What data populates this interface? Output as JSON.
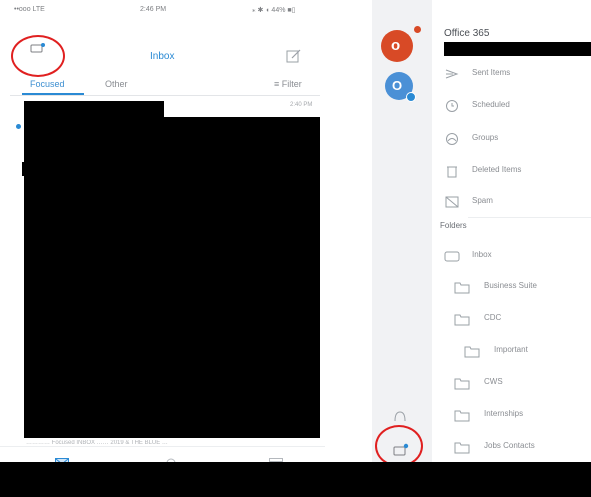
{
  "inbox": {
    "status_carrier": "••ooo LTE",
    "status_time": "2:46 PM",
    "status_battery": "⁎ ✱ ◖ 44% ■▯",
    "title": "Inbox",
    "tab_focused": "Focused",
    "tab_other": "Other",
    "filter_label": "≡ Filter",
    "message_time": "2:40 PM",
    "preview_text": "………… Focused INBOX …… 2019 & THE BLUE …"
  },
  "drawer": {
    "account_name": "Office 365",
    "accounts": [
      {
        "icon": "office-logo-icon",
        "letter": "o",
        "color": "#d84a26"
      },
      {
        "icon": "outlook-logo-icon",
        "letter": "O",
        "color": "#4a90d6"
      }
    ],
    "smart_items": [
      {
        "label": "Sent Items",
        "icon": "send-icon"
      },
      {
        "label": "Scheduled",
        "icon": "clock-icon"
      },
      {
        "label": "Groups",
        "icon": "groups-icon"
      },
      {
        "label": "Deleted Items",
        "icon": "trash-icon"
      },
      {
        "label": "Spam",
        "icon": "spam-icon"
      }
    ],
    "folders_header": "Folders",
    "folders": [
      {
        "label": "Inbox",
        "level": 0
      },
      {
        "label": "Business Suite",
        "level": 1
      },
      {
        "label": "CDC",
        "level": 1
      },
      {
        "label": "Important",
        "level": 2
      },
      {
        "label": "CWS",
        "level": 1
      },
      {
        "label": "Internships",
        "level": 1
      },
      {
        "label": "Jobs Contacts",
        "level": 1
      }
    ]
  },
  "annotations": {
    "ring_color": "#e02020"
  },
  "colors": {
    "accent": "#2a8ad4",
    "office": "#d84a26",
    "outlook": "#4a90d6"
  }
}
